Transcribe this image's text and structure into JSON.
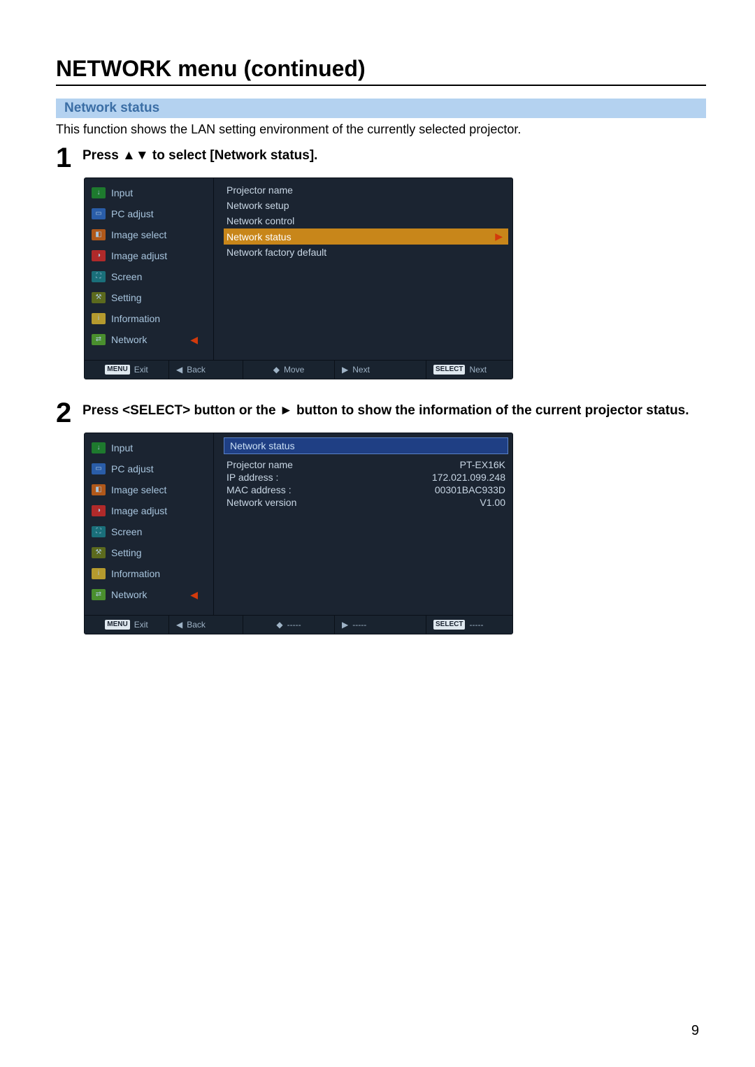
{
  "page": {
    "title": "NETWORK menu (continued)",
    "section_title": "Network status",
    "section_desc": "This function shows the LAN setting environment of the currently selected projector.",
    "page_number": "9"
  },
  "steps": [
    {
      "num": "1",
      "text": "Press ▲▼ to select [Network status]."
    },
    {
      "num": "2",
      "text": "Press <SELECT> button or the ► button to show the information of the current projector status."
    }
  ],
  "left_menu": [
    {
      "label": "Input"
    },
    {
      "label": "PC adjust"
    },
    {
      "label": "Image select"
    },
    {
      "label": "Image adjust"
    },
    {
      "label": "Screen"
    },
    {
      "label": "Setting"
    },
    {
      "label": "Information"
    },
    {
      "label": "Network"
    }
  ],
  "osd1_right": [
    {
      "label": "Projector name"
    },
    {
      "label": "Network setup"
    },
    {
      "label": "Network control"
    },
    {
      "label": "Network status",
      "highlight": true
    },
    {
      "label": "Network factory default"
    }
  ],
  "osd1_footer": {
    "menu_chip": "MENU",
    "exit": "Exit",
    "back_sym": "◀",
    "back": "Back",
    "move_sym": "◆",
    "move": "Move",
    "next_sym": "▶",
    "next": "Next",
    "select_chip": "SELECT",
    "select_next": "Next"
  },
  "osd2_header": "Network status",
  "osd2_rows": [
    {
      "key": "Projector name",
      "value": "PT-EX16K"
    },
    {
      "key": "IP address :",
      "value": "172.021.099.248"
    },
    {
      "key": "MAC address :",
      "value": "00301BAC933D"
    },
    {
      "key": "Network version",
      "value": "V1.00"
    }
  ],
  "osd2_footer": {
    "menu_chip": "MENU",
    "exit": "Exit",
    "back_sym": "◀",
    "back": "Back",
    "move_sym": "◆",
    "move": "-----",
    "next_sym": "▶",
    "next": "-----",
    "select_chip": "SELECT",
    "select_next": "-----"
  }
}
